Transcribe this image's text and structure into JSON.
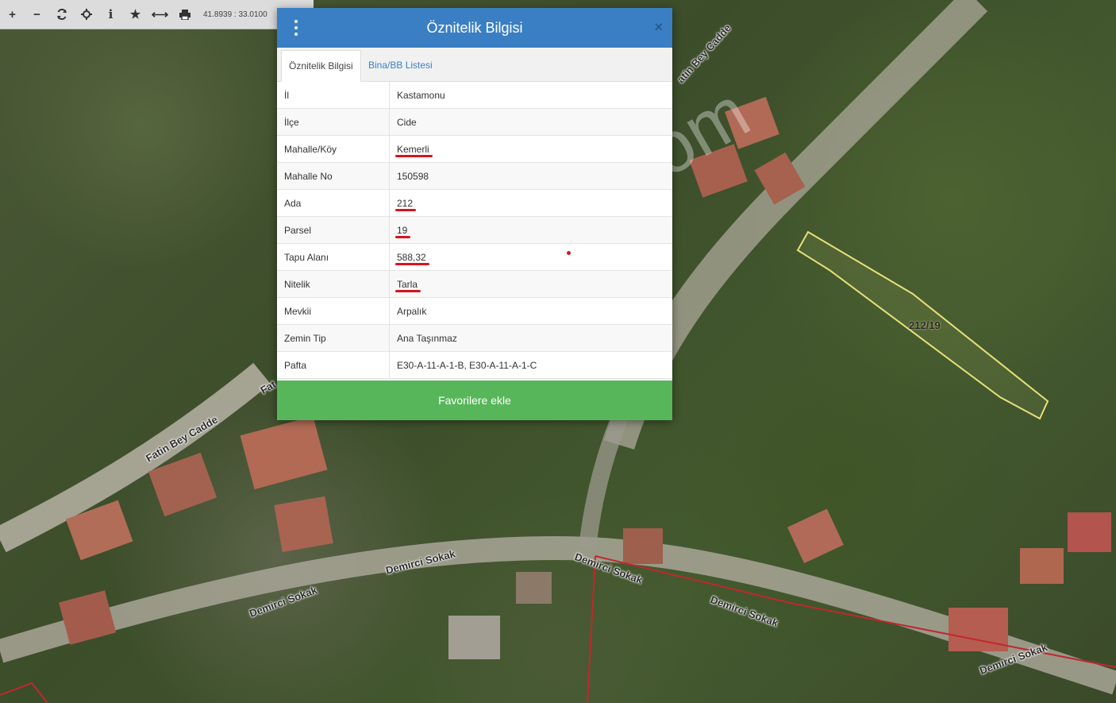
{
  "toolbar": {
    "coords": "41.8939 : 33.0100",
    "buttons": [
      "zoom-in",
      "zoom-out",
      "refresh",
      "crosshair",
      "info",
      "favorite",
      "measure",
      "print"
    ]
  },
  "dialog": {
    "title": "Öznitelik Bilgisi",
    "tabs": [
      {
        "label": "Öznitelik Bilgisi",
        "active": true
      },
      {
        "label": "Bina/BB Listesi",
        "active": false
      }
    ],
    "rows": [
      {
        "key": "İl",
        "value": "Kastamonu",
        "underlined": false
      },
      {
        "key": "İlçe",
        "value": "Cide",
        "underlined": false
      },
      {
        "key": "Mahalle/Köy",
        "value": "Kemerli",
        "underlined": true
      },
      {
        "key": "Mahalle No",
        "value": "150598",
        "underlined": false
      },
      {
        "key": "Ada",
        "value": "212",
        "underlined": true
      },
      {
        "key": "Parsel",
        "value": "19",
        "underlined": true
      },
      {
        "key": "Tapu Alanı",
        "value": "588,32",
        "underlined": true
      },
      {
        "key": "Nitelik",
        "value": "Tarla",
        "underlined": true
      },
      {
        "key": "Mevkii",
        "value": "Arpalık",
        "underlined": false
      },
      {
        "key": "Zemin Tip",
        "value": "Ana Taşınmaz",
        "underlined": false
      },
      {
        "key": "Pafta",
        "value": "E30-A-11-A-1-B, E30-A-11-A-1-C",
        "underlined": false
      }
    ],
    "favorite_button": "Favorilere ekle"
  },
  "map": {
    "parcel_label": "212/19",
    "streets": {
      "fatin_bey_1": "Fatin Bey Cadde",
      "fatin_bey_2": "atin Bey Cadde",
      "fatin_bey_3": "Fat",
      "demirci_1": "Demirci Sokak",
      "demirci_2": "Demirci Sokak",
      "demirci_3": "Demirci Sokak",
      "demirci_4": "Demirci Sokak",
      "demirci_5": "Demirci Sokak"
    },
    "watermark": "emlakjet.com",
    "colors": {
      "parcel_outline": "#e6e07a",
      "cadastre_line": "#c0282d"
    }
  }
}
